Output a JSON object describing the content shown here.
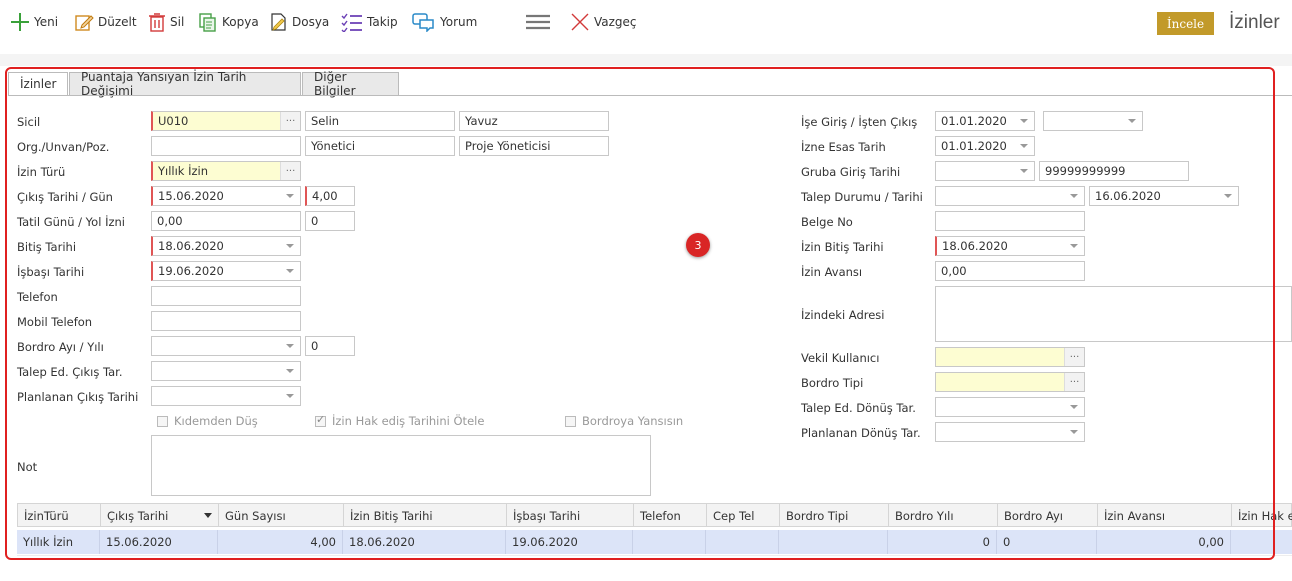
{
  "toolbar": {
    "new": "Yeni",
    "edit": "Düzelt",
    "delete": "Sil",
    "copy": "Kopya",
    "file": "Dosya",
    "track": "Takip",
    "comment": "Yorum",
    "cancel": "Vazgeç",
    "inspect": "İncele",
    "title": "İzinler"
  },
  "tabs": [
    "İzinler",
    "Puantaja Yansıyan İzin Tarih Değişimi",
    "Diğer Bilgiler"
  ],
  "form_left": {
    "sicil_label": "Sicil",
    "sicil_code": "U010",
    "first_name": "Selin",
    "last_name": "Yavuz",
    "org_label": "Org./Unvan/Poz.",
    "org": "",
    "title": "Yönetici",
    "position": "Proje Yöneticisi",
    "leave_type_label": "İzin Türü",
    "leave_type": "Yıllık İzin",
    "exit_label": "Çıkış Tarihi / Gün",
    "exit_date": "15.06.2020",
    "exit_days": "4,00",
    "holiday_label": "Tatil Günü / Yol İzni",
    "holiday": "0,00",
    "road": "0",
    "end_label": "Bitiş Tarihi",
    "end_date": "18.06.2020",
    "start_label": "İşbaşı Tarihi",
    "start_date": "19.06.2020",
    "phone_label": "Telefon",
    "phone": "",
    "mobile_label": "Mobil Telefon",
    "mobile": "",
    "payroll_label": "Bordro Ayı / Yılı",
    "payroll_month": "",
    "payroll_year": "0",
    "req_exit_label": "Talep Ed. Çıkış Tar.",
    "req_exit": "",
    "plan_exit_label": "Planlanan Çıkış Tarihi",
    "plan_exit": "",
    "chk_kidem": "Kıdemden Düş",
    "chk_hak": "İzin Hak ediş Tarihini Ötele",
    "chk_bordro": "Bordroya Yansısın",
    "note_label": "Not"
  },
  "form_right": {
    "hire_label": "İşe Giriş / İşten Çıkış",
    "hire_date": "01.01.2020",
    "leave_date": "",
    "basis_label": "İzne Esas Tarih",
    "basis_date": "01.01.2020",
    "group_label": "Gruba Giriş Tarihi",
    "group_date": "",
    "group_code": "99999999999",
    "request_label": "Talep Durumu / Tarihi",
    "request_status": "",
    "request_date": "16.06.2020",
    "doc_label": "Belge No",
    "doc_no": "",
    "leave_end_label": "İzin Bitiş Tarihi",
    "leave_end": "18.06.2020",
    "advance_label": "İzin Avansı",
    "advance": "0,00",
    "address_label": "İzindeki Adresi",
    "proxy_label": "Vekil Kullanıcı",
    "proxy": "",
    "payroll_type_label": "Bordro Tipi",
    "payroll_type": "",
    "req_return_label": "Talep Ed. Dönüş Tar.",
    "req_return": "",
    "plan_return_label": "Planlanan Dönüş Tar.",
    "plan_return": ""
  },
  "grid": {
    "headers": [
      "İzinTürü",
      "Çıkış Tarihi",
      "Gün Sayısı",
      "İzin Bitiş Tarihi",
      "İşbaşı Tarihi",
      "Telefon",
      "Cep Tel",
      "Bordro Tipi",
      "Bordro Yılı",
      "Bordro Ayı",
      "İzin Avansı",
      "İzin Hak e"
    ],
    "rows": [
      [
        "Yıllık İzin",
        "15.06.2020",
        "4,00",
        "18.06.2020",
        "19.06.2020",
        "",
        "",
        "",
        "0",
        "0",
        "0,00",
        ""
      ]
    ]
  },
  "annotation_badge": "3",
  "colors": {
    "accent": "#c29a2a",
    "required": "#e05555",
    "selected_row": "#dce4f8",
    "annotation": "#e02020"
  }
}
